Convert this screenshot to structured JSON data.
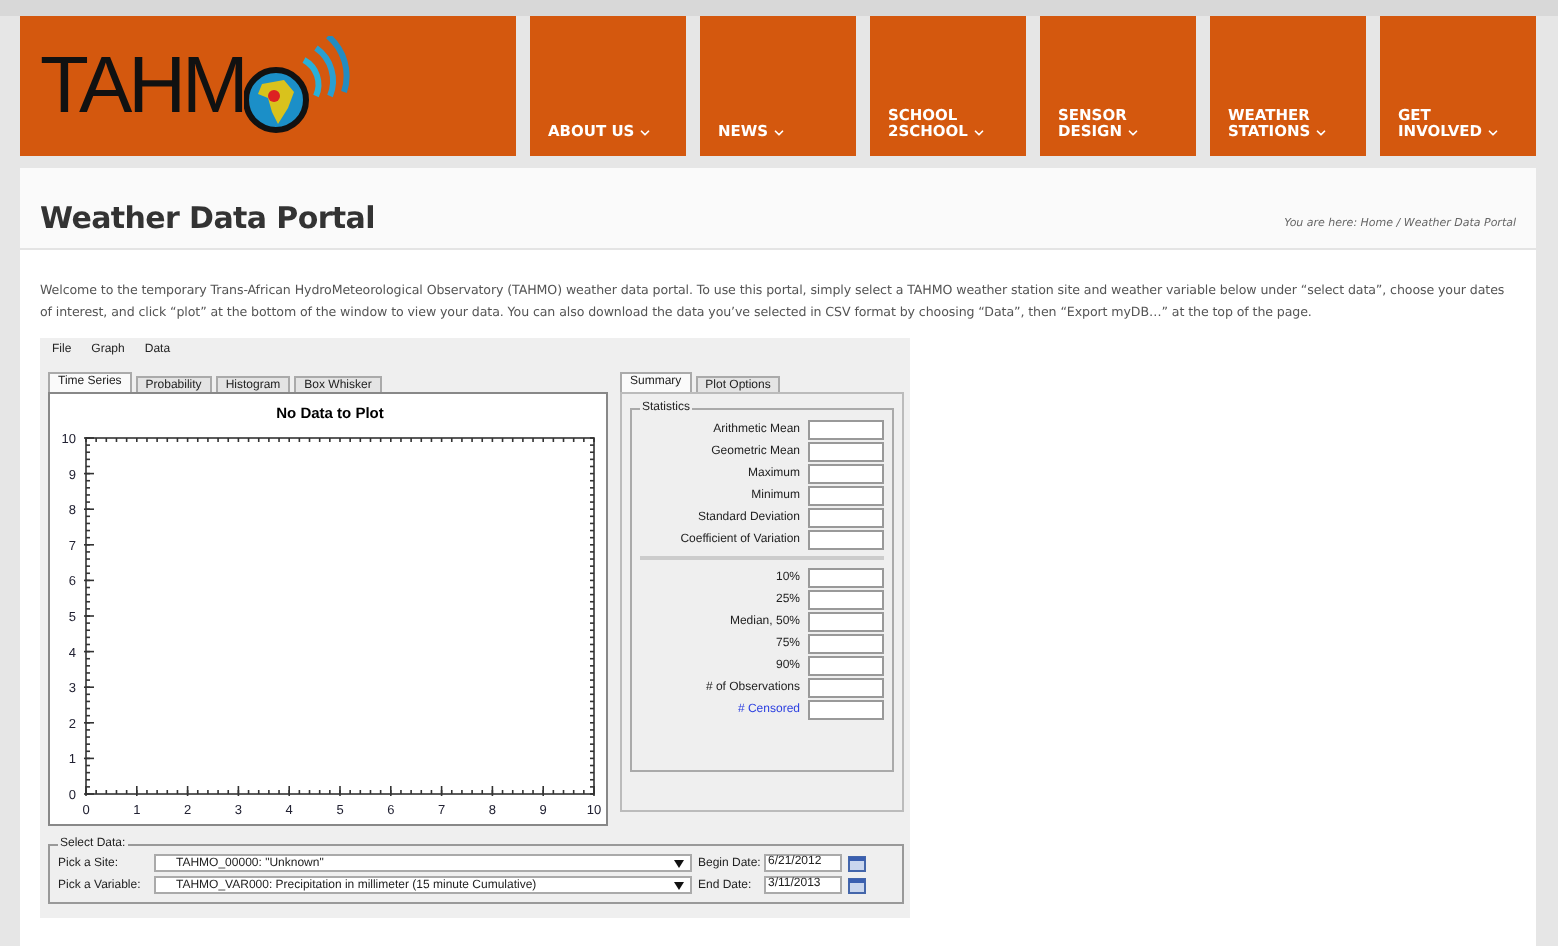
{
  "logo": {
    "text": "TAHM"
  },
  "nav": [
    {
      "lines": [
        "ABOUT US"
      ]
    },
    {
      "lines": [
        "NEWS"
      ]
    },
    {
      "lines": [
        "SCHOOL",
        "2SCHOOL"
      ]
    },
    {
      "lines": [
        "SENSOR",
        "DESIGN"
      ]
    },
    {
      "lines": [
        "WEATHER",
        "STATIONS"
      ]
    },
    {
      "lines": [
        "GET",
        "INVOLVED"
      ]
    }
  ],
  "page_title": "Weather Data Portal",
  "breadcrumb": "You are here: Home / Weather Data Portal",
  "intro": "Welcome to the temporary Trans-African HydroMeteorological Observatory (TAHMO) weather data portal. To use this portal, simply select a TAHMO weather station site and weather variable below under “select data”, choose your dates of interest, and click “plot” at the bottom of the window to view your data. You can also download the data you’ve selected in CSV format by choosing “Data”, then “Export myDB…” at the top of the page.",
  "menu": [
    "File",
    "Graph",
    "Data"
  ],
  "plot_tabs": [
    {
      "label": "Time Series",
      "selected": true
    },
    {
      "label": "Probability",
      "selected": false
    },
    {
      "label": "Histogram",
      "selected": false
    },
    {
      "label": "Box Whisker",
      "selected": false
    }
  ],
  "chart": {
    "chart_data": {
      "type": "line",
      "title": "No Data to Plot",
      "xlim": [
        0,
        10
      ],
      "ylim": [
        0,
        10
      ],
      "xticks": [
        0,
        1,
        2,
        3,
        4,
        5,
        6,
        7,
        8,
        9,
        10
      ],
      "yticks": [
        0,
        1,
        2,
        3,
        4,
        5,
        6,
        7,
        8,
        9,
        10
      ]
    }
  },
  "side_tabs": [
    {
      "label": "Summary",
      "selected": true
    },
    {
      "label": "Plot Options",
      "selected": false
    }
  ],
  "statistics": {
    "legend": "Statistics",
    "group_1": [
      {
        "label": "Arithmetic Mean",
        "kind": "label"
      },
      {
        "label": "Geometric Mean",
        "kind": "label"
      },
      {
        "label": "Maximum",
        "kind": "label"
      },
      {
        "label": "Minimum",
        "kind": "label"
      },
      {
        "label": "Standard Deviation",
        "kind": "label"
      },
      {
        "label": "Coefficient of Variation",
        "kind": "label"
      }
    ],
    "group_2": [
      {
        "label": "10%",
        "kind": "label"
      },
      {
        "label": "25%",
        "kind": "label"
      },
      {
        "label": "Median, 50%",
        "kind": "label"
      },
      {
        "label": "75%",
        "kind": "label"
      },
      {
        "label": "90%",
        "kind": "label"
      },
      {
        "label": "# of Observations",
        "kind": "label"
      },
      {
        "label": "# Censored",
        "kind": "link"
      }
    ]
  },
  "select_data": {
    "legend": "Select Data:",
    "rows": [
      {
        "label": "Pick a Site:",
        "value": "TAHMO_00000: \"Unknown\"",
        "date_label": "Begin Date:",
        "date": "6/21/2012"
      },
      {
        "label": "Pick a Variable:",
        "value": "TAHMO_VAR000: Precipitation in millimeter (15 minute Cumulative)",
        "date_label": "End Date:",
        "date": "3/11/2013"
      }
    ]
  }
}
